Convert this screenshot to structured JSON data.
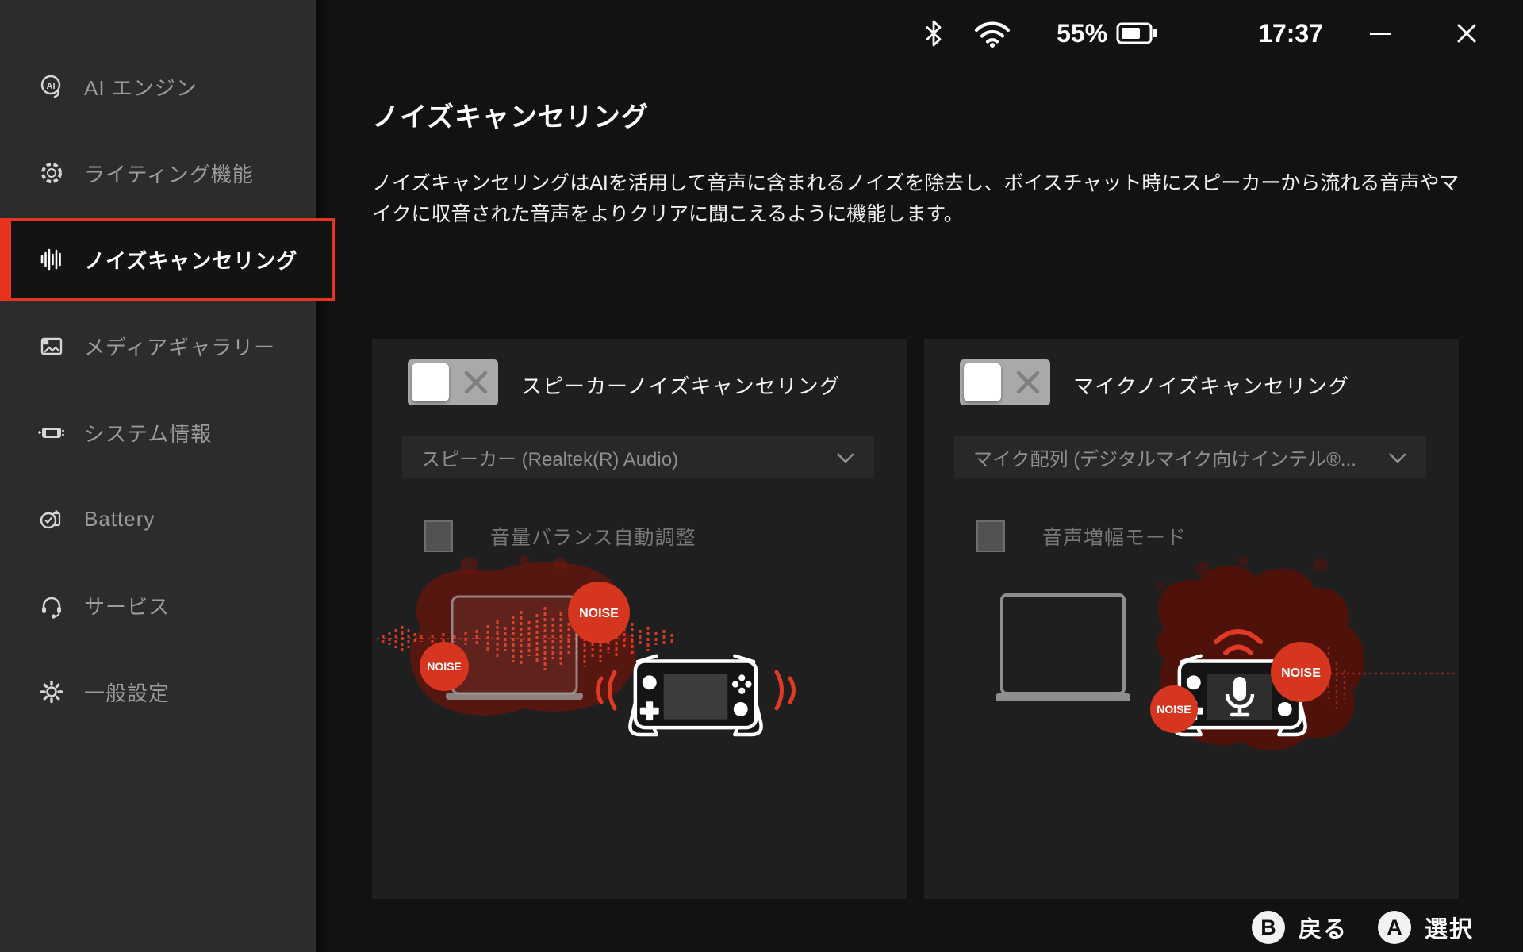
{
  "colors": {
    "accent_red": "#e8331f",
    "noise_red": "#d6351f",
    "sidebar_bg": "#2c2c2e",
    "panel_bg": "#1f1f1f",
    "main_bg": "#121212"
  },
  "status_bar": {
    "battery_percent": "55%",
    "time": "17:37"
  },
  "sidebar": {
    "items": [
      {
        "label": "AI エンジン",
        "icon": "ai-chat",
        "selected": false
      },
      {
        "label": "ライティング機能",
        "icon": "lighting-ring",
        "selected": false
      },
      {
        "label": "ノイズキャンセリング",
        "icon": "audio-waveform",
        "selected": true
      },
      {
        "label": "メディアギャラリー",
        "icon": "media-gallery",
        "selected": false
      },
      {
        "label": "システム情報",
        "icon": "handheld-console",
        "selected": false
      },
      {
        "label": "Battery",
        "icon": "battery-clock",
        "selected": false
      },
      {
        "label": "サービス",
        "icon": "headset",
        "selected": false
      },
      {
        "label": "一般設定",
        "icon": "gear",
        "selected": false
      }
    ]
  },
  "page": {
    "title": "ノイズキャンセリング",
    "description": "ノイズキャンセリングはAIを活用して音声に含まれるノイズを除去し、ボイスチャット時にスピーカーから流れる音声やマイクに収音された音声をよりクリアに聞こえるように機能します。"
  },
  "panels": [
    {
      "title": "スピーカーノイズキャンセリング",
      "toggle_state": "off",
      "device": "スピーカー (Realtek(R) Audio)",
      "checkbox_label": "音量バランス自動調整",
      "checkbox_checked": false,
      "noise_labels": [
        "NOISE",
        "NOISE"
      ]
    },
    {
      "title": "マイクノイズキャンセリング",
      "toggle_state": "off",
      "device": "マイク配列 (デジタルマイク向けインテル®...",
      "checkbox_label": "音声増幅モード",
      "checkbox_checked": false,
      "noise_labels": [
        "NOISE",
        "NOISE"
      ]
    }
  ],
  "footer_hints": [
    {
      "button": "B",
      "label": "戻る"
    },
    {
      "button": "A",
      "label": "選択"
    }
  ]
}
